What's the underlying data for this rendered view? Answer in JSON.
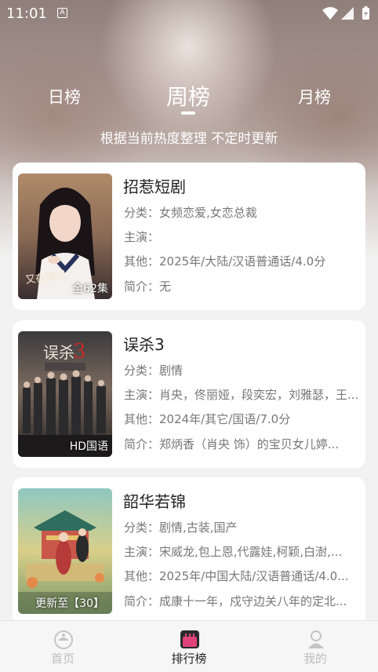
{
  "status_bar": {
    "time": "11:01",
    "small_icon_letter": "A"
  },
  "tabs": [
    {
      "label": "日榜"
    },
    {
      "label": "周榜"
    },
    {
      "label": "月榜"
    }
  ],
  "subtitle": "根据当前热度整理 不定时更新",
  "dramas": [
    {
      "title": "招惹短剧",
      "category": "分类：女频恋爱,女恋总裁",
      "cast": "主演：",
      "other": "其他：2025年/大陆/汉语普通话/4.0分",
      "summary": "简介：无",
      "badge": "全62集"
    },
    {
      "title": "误杀3",
      "category": "分类：剧情",
      "cast": "主演：肖央，佟丽娅，段奕宏，刘雅瑟，王...",
      "other": "其他：2024年/其它/国语/7.0分",
      "summary": "简介：郑炳香（肖央 饰）的宝贝女儿婷...",
      "badge": "HD国语",
      "poster_text": "误杀"
    },
    {
      "title": "韶华若锦",
      "category": "分类：剧情,古装,国产",
      "cast": "主演：宋威龙,包上恩,代露娃,柯颖,白澍,...",
      "other": "其他：2025年/中国大陆/汉语普通话/4.0...",
      "summary": "简介：成康十一年，戍守边关八年的定北...",
      "badge": "更新至【30】"
    }
  ],
  "bottom_nav": [
    {
      "label": "首页",
      "icon": "home-icon"
    },
    {
      "label": "排行榜",
      "icon": "ranking-icon"
    },
    {
      "label": "我的",
      "icon": "profile-icon"
    }
  ],
  "colors": {
    "accent": "#e0437a",
    "text_dark": "#222222",
    "text_muted": "#777777"
  }
}
